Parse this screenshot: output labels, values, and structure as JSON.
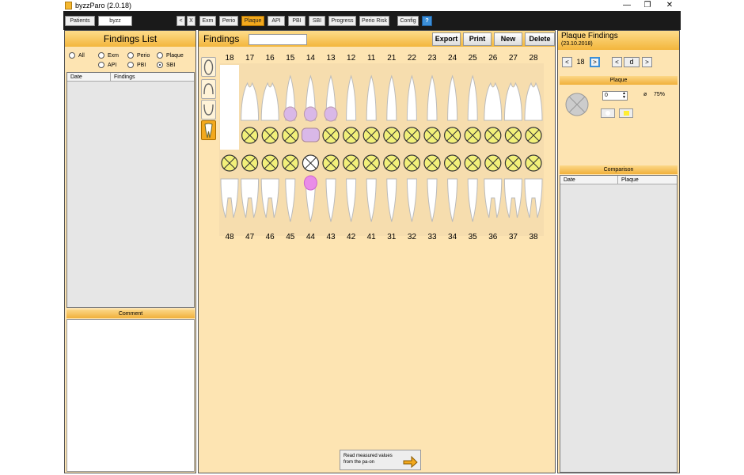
{
  "window": {
    "title": "byzzParo (2.0.18)"
  },
  "toolbar": {
    "patients": "Patients",
    "patient_name": "byzz",
    "prev": "<",
    "close": "X",
    "tabs": [
      "Exm",
      "Perio",
      "Plaque",
      "API",
      "PBI",
      "SBI",
      "Progress",
      "Perio Risk"
    ],
    "config": "Config",
    "help": "?",
    "active_tab": "Plaque"
  },
  "left": {
    "title": "Findings List",
    "filters": [
      {
        "label": "All",
        "checked": false
      },
      {
        "label": "Exm",
        "checked": false
      },
      {
        "label": "Perio",
        "checked": false
      },
      {
        "label": "Plaque",
        "checked": false
      },
      {
        "label": "API",
        "checked": false
      },
      {
        "label": "PBI",
        "checked": false
      },
      {
        "label": "SBI",
        "checked": true
      }
    ],
    "col_date": "Date",
    "col_findings": "Findings",
    "comment": "Comment"
  },
  "center": {
    "title": "Findings",
    "export": "Export",
    "print": "Print",
    "new": "New",
    "delete": "Delete",
    "upper": [
      "18",
      "17",
      "16",
      "15",
      "14",
      "13",
      "12",
      "11",
      "21",
      "22",
      "23",
      "24",
      "25",
      "26",
      "27",
      "28"
    ],
    "lower": [
      "48",
      "47",
      "46",
      "45",
      "44",
      "43",
      "42",
      "41",
      "31",
      "32",
      "33",
      "34",
      "35",
      "36",
      "37",
      "38"
    ],
    "read_line1": "Read measured values",
    "read_line2": "from the pa-on"
  },
  "right": {
    "title": "Plaque Findings",
    "date": "(23.10.2018)",
    "tooth": "18",
    "surface": "d",
    "prev": "<",
    "next": ">",
    "plaque_header": "Plaque",
    "value": "0",
    "avg_symbol": "ø",
    "avg": "75%",
    "comparison": "Comparison",
    "col_date": "Date",
    "col_plaque": "Plaque"
  },
  "colors": {
    "accent": "#f3a91d",
    "panel": "#fde4b2",
    "plaque_fill": "#f2f07a",
    "crown_purple": "#d9b8e8",
    "pink": "#e98ce8"
  }
}
